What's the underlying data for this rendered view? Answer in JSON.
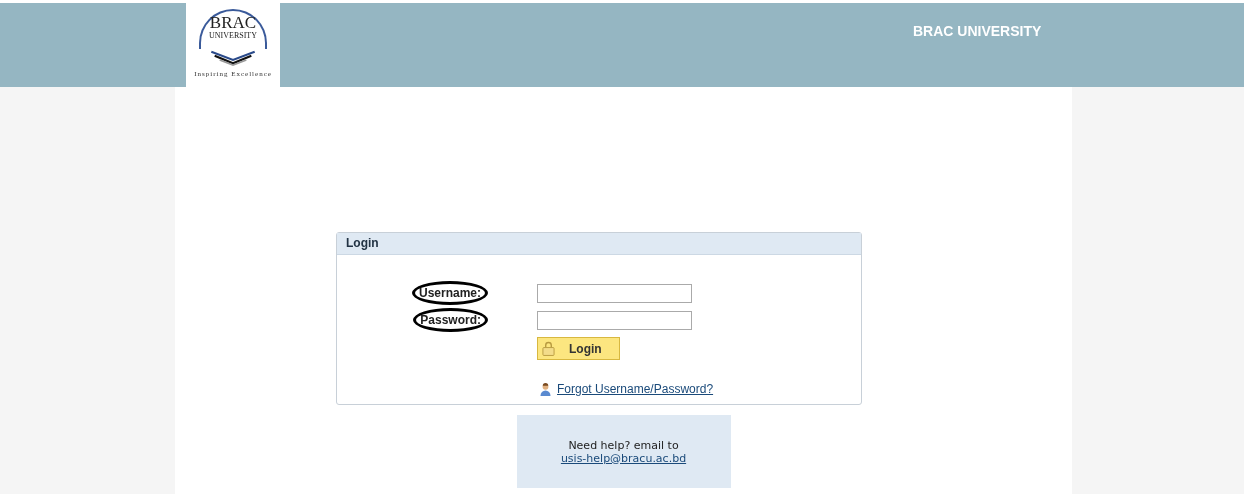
{
  "header": {
    "logo": {
      "name_lines": [
        "BRAC",
        "UNIVERSITY"
      ],
      "tagline": "Inspiring Excellence"
    },
    "title": "BRAC UNIVERSITY"
  },
  "login_panel": {
    "title": "Login",
    "fields": [
      {
        "label": "Username:",
        "circled": true
      },
      {
        "label": "Password:",
        "circled": true
      }
    ],
    "button": "Login",
    "forgot_link": "Forgot Username/Password?"
  },
  "help": {
    "text": "Need help? email to",
    "email": "usis-help@bracu.ac.bd"
  }
}
